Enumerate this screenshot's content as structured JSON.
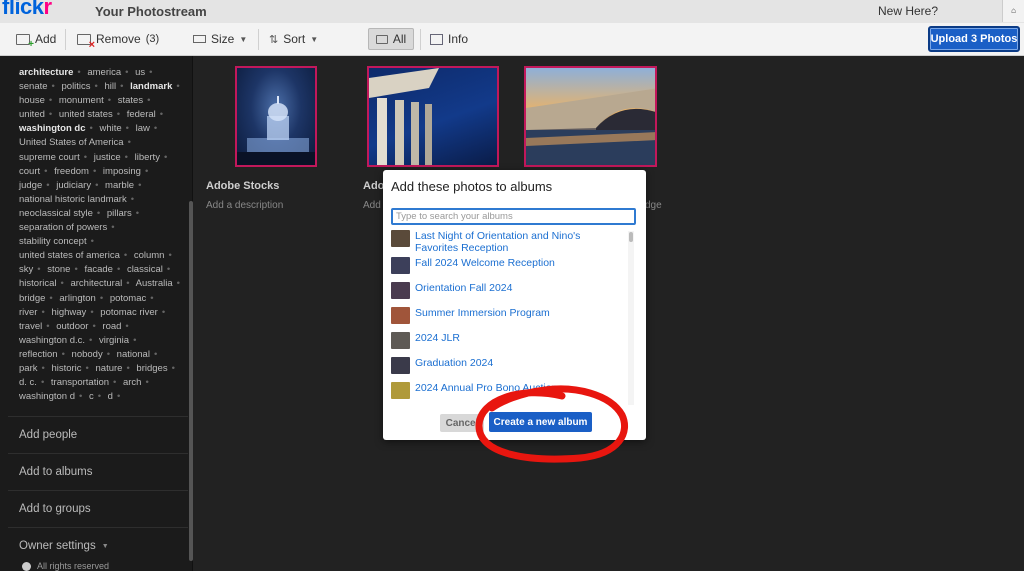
{
  "topbar": {
    "logo_main": "flick",
    "logo_accent": "r",
    "page_title": "Your Photostream",
    "new_here": "New Here?"
  },
  "toolbar": {
    "add_label": "Add",
    "remove_label": "Remove",
    "remove_count": "(3)",
    "size_label": "Size",
    "sort_label": "Sort",
    "all_label": "All",
    "info_label": "Info",
    "upload_label": "Upload 3 Photos"
  },
  "sidebar": {
    "tags": [
      {
        "t": "architecture",
        "b": true
      },
      {
        "t": "america"
      },
      {
        "t": "us"
      },
      {
        "t": "senate"
      },
      {
        "t": "politics"
      },
      {
        "t": "hill"
      },
      {
        "t": "landmark",
        "b": true
      },
      {
        "t": "house"
      },
      {
        "t": "monument"
      },
      {
        "t": "states"
      },
      {
        "t": "united"
      },
      {
        "t": "united states"
      },
      {
        "t": "federal"
      },
      {
        "t": "washington dc",
        "b": true
      },
      {
        "t": "white"
      },
      {
        "t": "law"
      },
      {
        "t": "United States of America"
      },
      {
        "t": "supreme court"
      },
      {
        "t": "justice"
      },
      {
        "t": "liberty"
      },
      {
        "t": "court"
      },
      {
        "t": "freedom"
      },
      {
        "t": "imposing"
      },
      {
        "t": "judge"
      },
      {
        "t": "judiciary"
      },
      {
        "t": "marble"
      },
      {
        "t": "national historic landmark"
      },
      {
        "t": "neoclassical style"
      },
      {
        "t": "pillars"
      },
      {
        "t": "separation of powers"
      },
      {
        "t": "stability concept"
      },
      {
        "t": "united states of america"
      },
      {
        "t": "column"
      },
      {
        "t": "sky"
      },
      {
        "t": "stone"
      },
      {
        "t": "facade"
      },
      {
        "t": "classical"
      },
      {
        "t": "historical"
      },
      {
        "t": "architectural"
      },
      {
        "t": "Australia"
      },
      {
        "t": "bridge"
      },
      {
        "t": "arlington"
      },
      {
        "t": "potomac"
      },
      {
        "t": "river"
      },
      {
        "t": "highway"
      },
      {
        "t": "potomac river"
      },
      {
        "t": "travel"
      },
      {
        "t": "outdoor"
      },
      {
        "t": "road"
      },
      {
        "t": "washington d.c."
      },
      {
        "t": "virginia"
      },
      {
        "t": "reflection"
      },
      {
        "t": "nobody"
      },
      {
        "t": "national"
      },
      {
        "t": "park"
      },
      {
        "t": "historic"
      },
      {
        "t": "nature"
      },
      {
        "t": "bridges"
      },
      {
        "t": "d. c."
      },
      {
        "t": "transportation"
      },
      {
        "t": "arch"
      },
      {
        "t": "washington d"
      },
      {
        "t": "c"
      },
      {
        "t": "d"
      }
    ],
    "add_people": "Add people",
    "add_to_albums": "Add to albums",
    "add_to_groups": "Add to groups",
    "owner_settings": "Owner settings",
    "rights": "All rights reserved"
  },
  "photos": [
    {
      "title": "Adobe Stocks",
      "desc": "Add a description"
    },
    {
      "title": "Ado",
      "desc": "Add"
    },
    {
      "title": "",
      "desc": "dge"
    }
  ],
  "modal": {
    "title": "Add these photos to albums",
    "search_placeholder": "Type to search your albums",
    "albums": [
      {
        "name": "Last Night of Orientation and Nino's Favorites Reception",
        "thumb": "#5a4a3a"
      },
      {
        "name": "Fall 2024 Welcome Reception",
        "thumb": "#3c3f5a"
      },
      {
        "name": "Orientation Fall 2024",
        "thumb": "#4a3b4f"
      },
      {
        "name": "Summer Immersion Program",
        "thumb": "#a0553a"
      },
      {
        "name": "2024 JLR",
        "thumb": "#5e5a55"
      },
      {
        "name": "Graduation 2024",
        "thumb": "#3a3a4a"
      },
      {
        "name": "2024 Annual Pro Bono Auction",
        "thumb": "#b09a3a"
      }
    ],
    "cancel_label": "Cancel",
    "create_label": "Create a new album"
  },
  "colors": {
    "accent": "#1a5fc6",
    "link": "#1b6fd1",
    "photo_border": "#c2185b",
    "annotation": "#e8160f"
  }
}
